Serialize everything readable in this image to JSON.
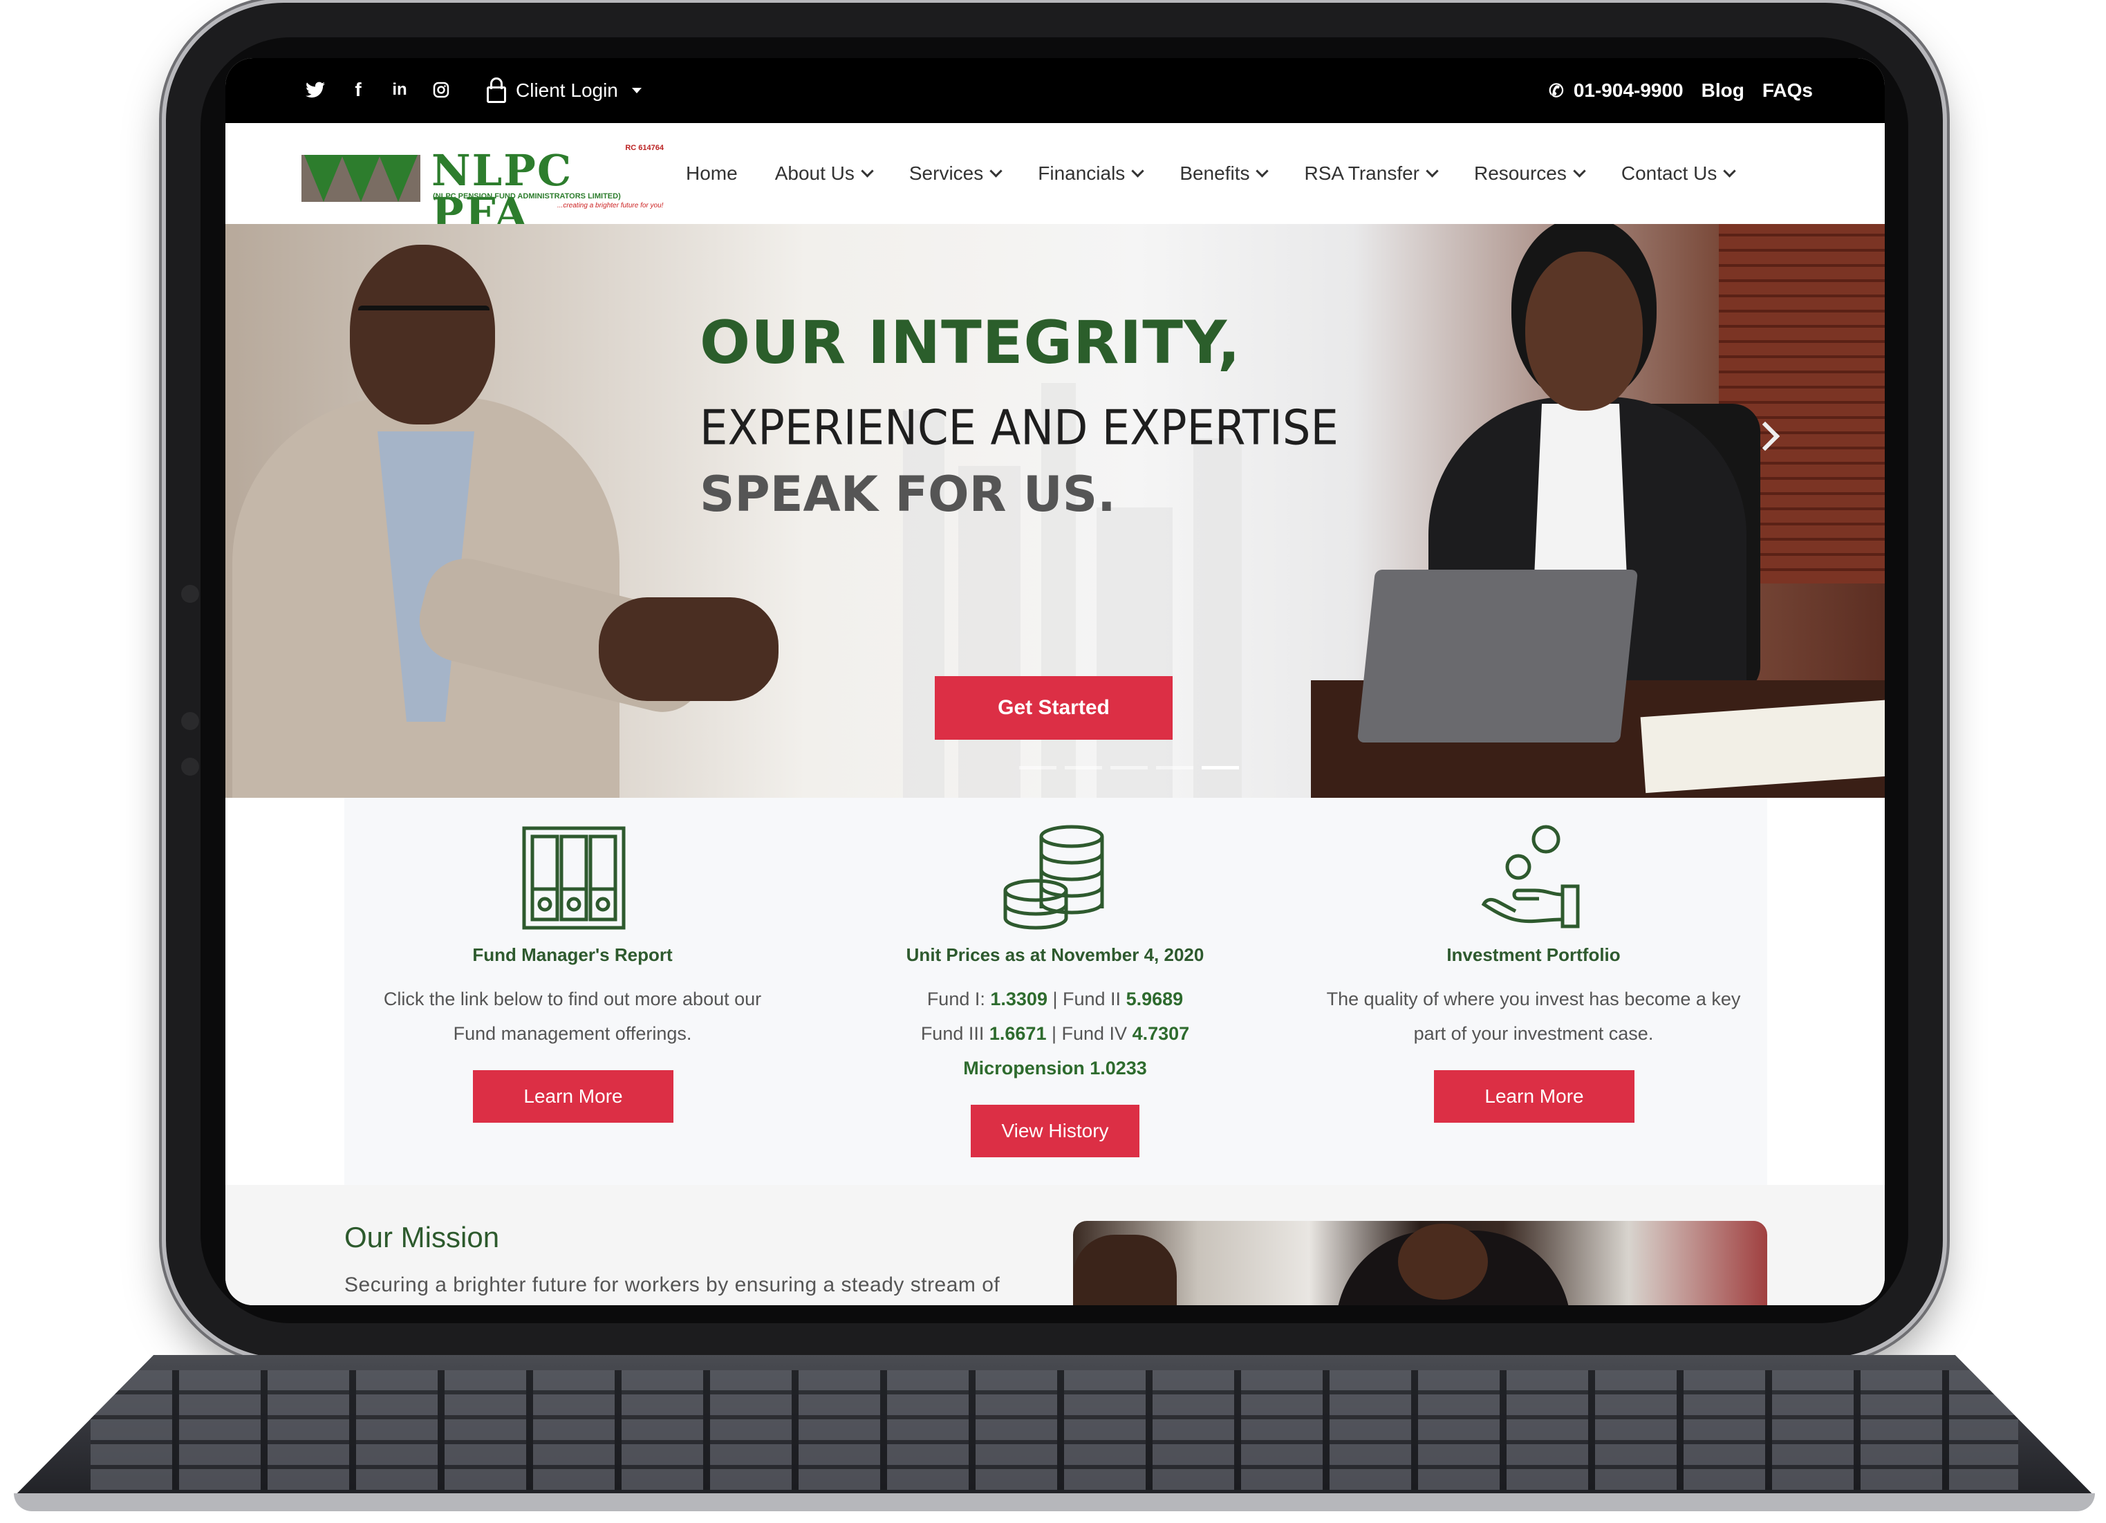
{
  "topbar": {
    "social": [
      {
        "name": "twitter-icon",
        "glyph": "🐦"
      },
      {
        "name": "facebook-icon",
        "glyph": "f"
      },
      {
        "name": "linkedin-icon",
        "glyph": "in"
      },
      {
        "name": "instagram-icon",
        "glyph": "◎"
      }
    ],
    "client_login": "Client Login",
    "phone": "01-904-9900",
    "blog": "Blog",
    "faqs": "FAQs"
  },
  "logo": {
    "brand": "NLPC PFA",
    "rc": "RC 614764",
    "subtitle": "(NLPC PENSION FUND ADMINISTRATORS LIMITED)",
    "tagline": "...creating a brighter future for you!"
  },
  "nav": [
    {
      "label": "Home",
      "dropdown": false
    },
    {
      "label": "About Us",
      "dropdown": true
    },
    {
      "label": "Services",
      "dropdown": true
    },
    {
      "label": "Financials",
      "dropdown": true
    },
    {
      "label": "Benefits",
      "dropdown": true
    },
    {
      "label": "RSA Transfer",
      "dropdown": true
    },
    {
      "label": "Resources",
      "dropdown": true
    },
    {
      "label": "Contact Us",
      "dropdown": true
    }
  ],
  "hero": {
    "line1": "OUR INTEGRITY,",
    "line2": "EXPERIENCE AND EXPERTISE",
    "line3": "SPEAK FOR US.",
    "cta": "Get Started",
    "slide_count": 5,
    "active_slide": 5
  },
  "features": {
    "fund_report": {
      "title": "Fund Manager's Report",
      "desc_line1": "Click the link below to find out more about our",
      "desc_line2": "Fund management offerings.",
      "button": "Learn More"
    },
    "unit_prices": {
      "title": "Unit Prices as at November 4, 2020",
      "fund1_label": "Fund I:",
      "fund1_value": "1.3309",
      "fund2_label": "Fund II",
      "fund2_value": "5.9689",
      "fund3_label": "Fund III",
      "fund3_value": "1.6671",
      "fund4_label": "Fund IV",
      "fund4_value": "4.7307",
      "micropension": "Micropension 1.0233",
      "separator": "|",
      "button": "View History"
    },
    "investment": {
      "title": "Investment Portfolio",
      "desc_line1": "The quality of where you invest has become a key",
      "desc_line2": "part of your investment case.",
      "button": "Learn More"
    }
  },
  "mission": {
    "title": "Our Mission",
    "text": "Securing a brighter future for workers by ensuring a steady stream of"
  },
  "colors": {
    "brand_green": "#2d7d2d",
    "heading_green": "#2b5e2b",
    "accent_red": "#dc2f45",
    "topbar_black": "#000000"
  }
}
